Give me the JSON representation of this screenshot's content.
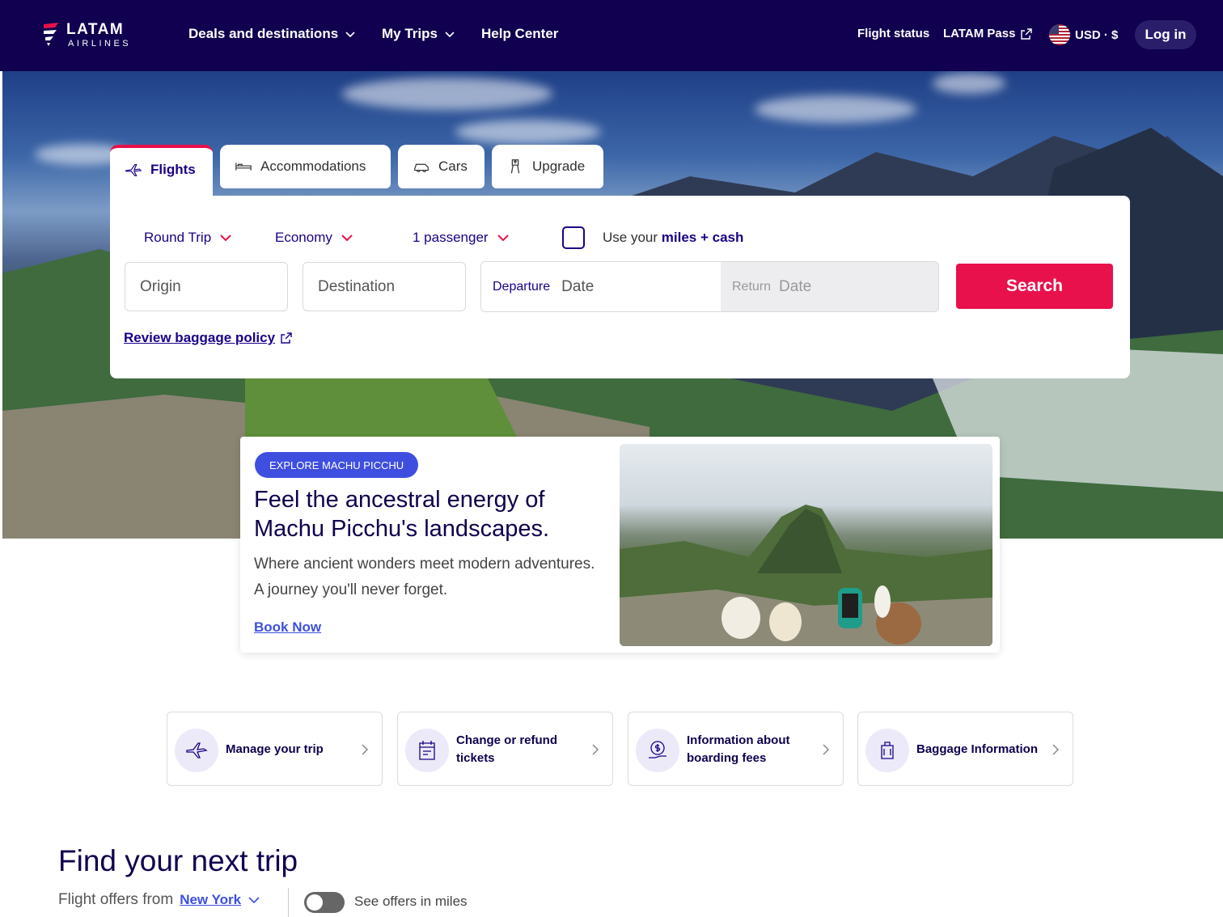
{
  "brand": {
    "name": "LATAM",
    "sub": "AIRLINES"
  },
  "nav": {
    "deals": "Deals and destinations",
    "trips": "My Trips",
    "help": "Help Center",
    "flight_status": "Flight status",
    "latam_pass": "LATAM Pass",
    "currency": "USD · $",
    "login": "Log in"
  },
  "tabs": {
    "flights": "Flights",
    "accommodations": "Accommodations",
    "cars": "Cars",
    "upgrade": "Upgrade"
  },
  "search": {
    "trip_type": "Round Trip",
    "cabin": "Economy",
    "passengers": "1 passenger",
    "miles_prefix": "Use your",
    "miles_bold": "miles + cash",
    "origin_placeholder": "Origin",
    "destination_placeholder": "Destination",
    "departure_label": "Departure",
    "departure_value": "Date",
    "return_label": "Return",
    "return_value": "Date",
    "button": "Search",
    "baggage_link": "Review baggage policy"
  },
  "promo": {
    "badge": "EXPLORE MACHU PICCHU",
    "title": "Feel the ancestral energy of Machu Picchu's landscapes.",
    "text": "Where ancient wonders meet modern adventures. A journey you'll never forget.",
    "link": "Book Now"
  },
  "quick_links": [
    {
      "label": "Manage your trip",
      "icon": "plane-icon"
    },
    {
      "label": "Change or refund tickets",
      "icon": "calendar-ticket-icon"
    },
    {
      "label": "Information about boarding fees",
      "icon": "money-hand-icon"
    },
    {
      "label": "Baggage Information",
      "icon": "luggage-icon"
    }
  ],
  "find": {
    "title": "Find your next trip",
    "offers_prefix": "Flight offers from",
    "city": "New York",
    "toggle_label": "See offers in miles"
  },
  "colors": {
    "nav_bg": "#10004f",
    "accent_red": "#e8114b",
    "brand_blue": "#1b0088",
    "link_blue": "#3e4fe0"
  }
}
